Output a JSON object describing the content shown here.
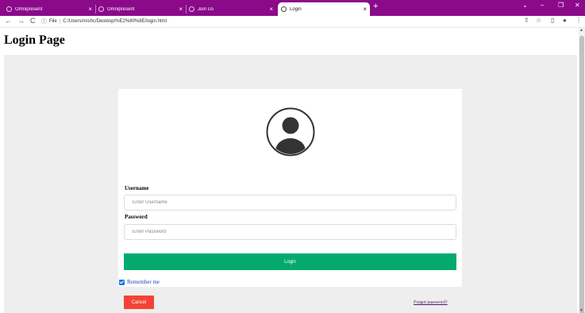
{
  "browser": {
    "tabs": [
      {
        "title": "Omnipresent",
        "active": false
      },
      {
        "title": "Omnipresent",
        "active": false
      },
      {
        "title": "Join Us",
        "active": false
      },
      {
        "title": "Login",
        "active": true
      }
    ],
    "tab_close_glyph": "×",
    "new_tab_glyph": "+",
    "window_controls": {
      "chevron": "⌄",
      "minimize": "–",
      "restore": "❐",
      "close": "✕"
    },
    "nav": {
      "back": "←",
      "forward": "→",
      "reload": "C"
    },
    "address": {
      "scheme_label": "File",
      "url": "C:/Users/mishc/Desktop/%E2%80%8E/login.html"
    },
    "toolbar_icons": {
      "share": "⇪",
      "bookmark": "☆",
      "sidepanel": "▯",
      "profile": "●",
      "menu": "⋮"
    }
  },
  "page": {
    "title": "Login Page",
    "form": {
      "username_label": "Username",
      "username_placeholder": "Enter Username",
      "password_label": "Password",
      "password_placeholder": "Enter Password",
      "login_label": "Login",
      "remember_label": "Remember me",
      "remember_checked": true,
      "cancel_label": "Cancel",
      "forgot_label": "Forgot password?"
    }
  },
  "colors": {
    "tabstrip": "#8a0a8a",
    "login_button": "#04aa6d",
    "cancel_button": "#f44336",
    "link": "#4b1a6e"
  }
}
